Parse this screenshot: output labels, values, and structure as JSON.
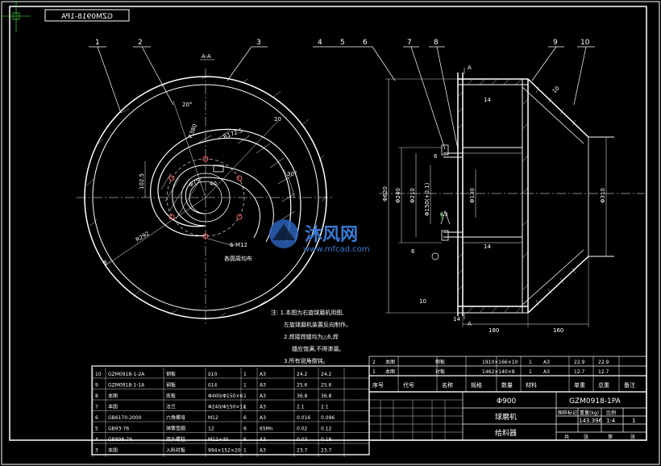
{
  "title_block_mirrored": "GZM0918-1PA",
  "callouts": [
    "1",
    "2",
    "3",
    "4",
    "5",
    "6",
    "7",
    "8",
    "9",
    "10"
  ],
  "section_label": "A-A",
  "section_mark": "A",
  "front_dims": {
    "angle_20": "20°",
    "r380": "R380",
    "r172": "R172.5",
    "d20": "20",
    "d102": "102.5",
    "d30": "30°",
    "d75": "Φ75",
    "d40": "40",
    "r292": "R292",
    "d8": "8",
    "bolt_note": "6-M12",
    "bolt_note2": "各圆周均布"
  },
  "side_dims": {
    "d620": "Φ620",
    "d240": "Φ240",
    "d210": "Φ210",
    "d150": "Φ150(+0.1)",
    "d130": "Φ130",
    "d310": "Φ310",
    "d14a": "14",
    "d14b": "14",
    "d14c": "14",
    "d10a": "10",
    "d10b": "10",
    "d6a": "6",
    "d6b": "6",
    "d63": "6.3",
    "d180": "180",
    "d160": "160"
  },
  "notes": [
    "注: 1.本图为右旋球磨机用图,",
    "左旋球磨机装置反向制作。",
    "2.焊接焊缝均为△6,焊",
    "缝应饱满,不得渗漏。",
    "3.所有锐角倒钝。"
  ],
  "bom_upper": [
    [
      "2",
      "本图",
      "侧板",
      "1910×166×10",
      "1",
      "A3",
      "22.9",
      "22.9",
      ""
    ],
    [
      "1",
      "本图",
      "衬板",
      "1462×140×8",
      "1",
      "A3",
      "12.7",
      "12.7",
      ""
    ]
  ],
  "bom_header": [
    "序号",
    "代号",
    "名称",
    "规格",
    "数量",
    "材料",
    "单重",
    "总重",
    "备注"
  ],
  "bom_lower": [
    [
      "10",
      "GZM0918-1-2A",
      "钢板",
      "δ10",
      "1",
      "A3",
      "24.2",
      "24.2",
      ""
    ],
    [
      "9",
      "GZM0918-1-1A",
      "钢板",
      "δ14",
      "1",
      "A3",
      "25.6",
      "25.6",
      ""
    ],
    [
      "8",
      "本图",
      "底板",
      "Φ400/Φ150×6",
      "1",
      "A3",
      "36.8",
      "36.8",
      ""
    ],
    [
      "7",
      "本图",
      "法兰",
      "Φ240/Φ150×14",
      "1",
      "A3",
      "2.1",
      "2.1",
      ""
    ],
    [
      "6",
      "GB6170-2000",
      "六角螺母",
      "M12",
      "6",
      "A3",
      "0.016",
      "0.096",
      ""
    ],
    [
      "5",
      "GB93-76",
      "弹簧垫圈",
      "12",
      "6",
      "65Mn",
      "0.02",
      "0.12",
      ""
    ],
    [
      "4",
      "GB898-76",
      "双头螺柱",
      "M12×40",
      "6",
      "A3",
      "0.03",
      "0.18",
      ""
    ],
    [
      "3",
      "本图",
      "入料衬板",
      "994×152×20",
      "1",
      "A3",
      "23.7",
      "23.7",
      ""
    ]
  ],
  "title_block": {
    "spec": "Φ900",
    "machine": "球磨机",
    "part": "给料器",
    "drawing_no": "GZM0918-1PA",
    "mass": "143.396",
    "scale": "1:4",
    "sheet": "1",
    "small_labels": [
      "图样标记",
      "重量(kg)",
      "比例",
      "共",
      "张",
      "第",
      "张"
    ]
  },
  "watermark": {
    "brand": "沐风网",
    "url": "www.mfcad.com"
  },
  "colors": {
    "line": "#ffffff",
    "accent": "#ff4040",
    "hatch": "#ffffff",
    "green": "#00c000",
    "watermark": "#3a7bd5"
  }
}
